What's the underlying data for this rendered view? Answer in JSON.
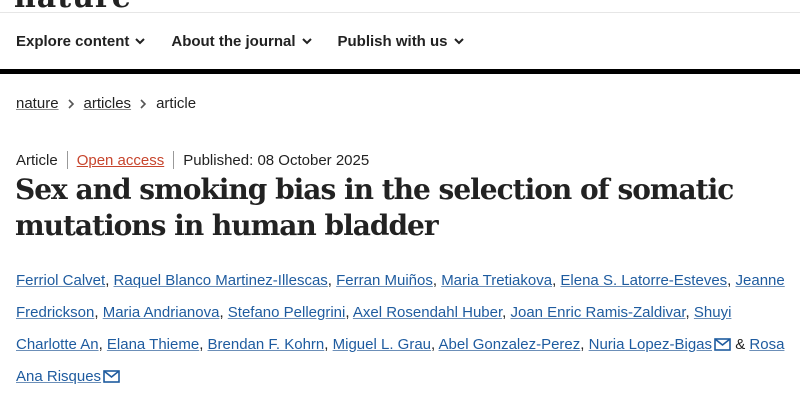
{
  "masthead": {
    "logo_text": "nature"
  },
  "nav": {
    "items": [
      {
        "label": "Explore content",
        "icon": "chevron-down-icon"
      },
      {
        "label": "About the journal",
        "icon": "chevron-down-icon"
      },
      {
        "label": "Publish with us",
        "icon": "chevron-down-icon"
      }
    ]
  },
  "breadcrumb": {
    "items": [
      {
        "label": "nature",
        "link": true
      },
      {
        "label": "articles",
        "link": true
      },
      {
        "label": "article",
        "link": false
      }
    ]
  },
  "article": {
    "type": "Article",
    "access": "Open access",
    "published": "Published: 08 October 2025",
    "title": "Sex and smoking bias in the selection of somatic mutations in human bladder",
    "authors": [
      "Ferriol Calvet",
      "Raquel Blanco Martinez-Illescas",
      "Ferran Muiños",
      "Maria Tretiakova",
      "Elena S. Latorre-Esteves",
      "Jeanne Fredrickson",
      "Maria Andrianova",
      "Stefano Pellegrini",
      "Axel Rosendahl Huber",
      "Joan Enric Ramis-Zaldivar",
      "Shuyi Charlotte An",
      "Elana Thieme",
      "Brendan F. Kohrn",
      "Miguel L. Grau",
      "Abel Gonzalez-Perez",
      "Nuria Lopez-Bigas",
      "Rosa Ana Risques"
    ],
    "last_author_joiner": "&"
  },
  "colors": {
    "link": "#1e5b9f",
    "open_access": "#c7452d",
    "rule": "#000000"
  }
}
